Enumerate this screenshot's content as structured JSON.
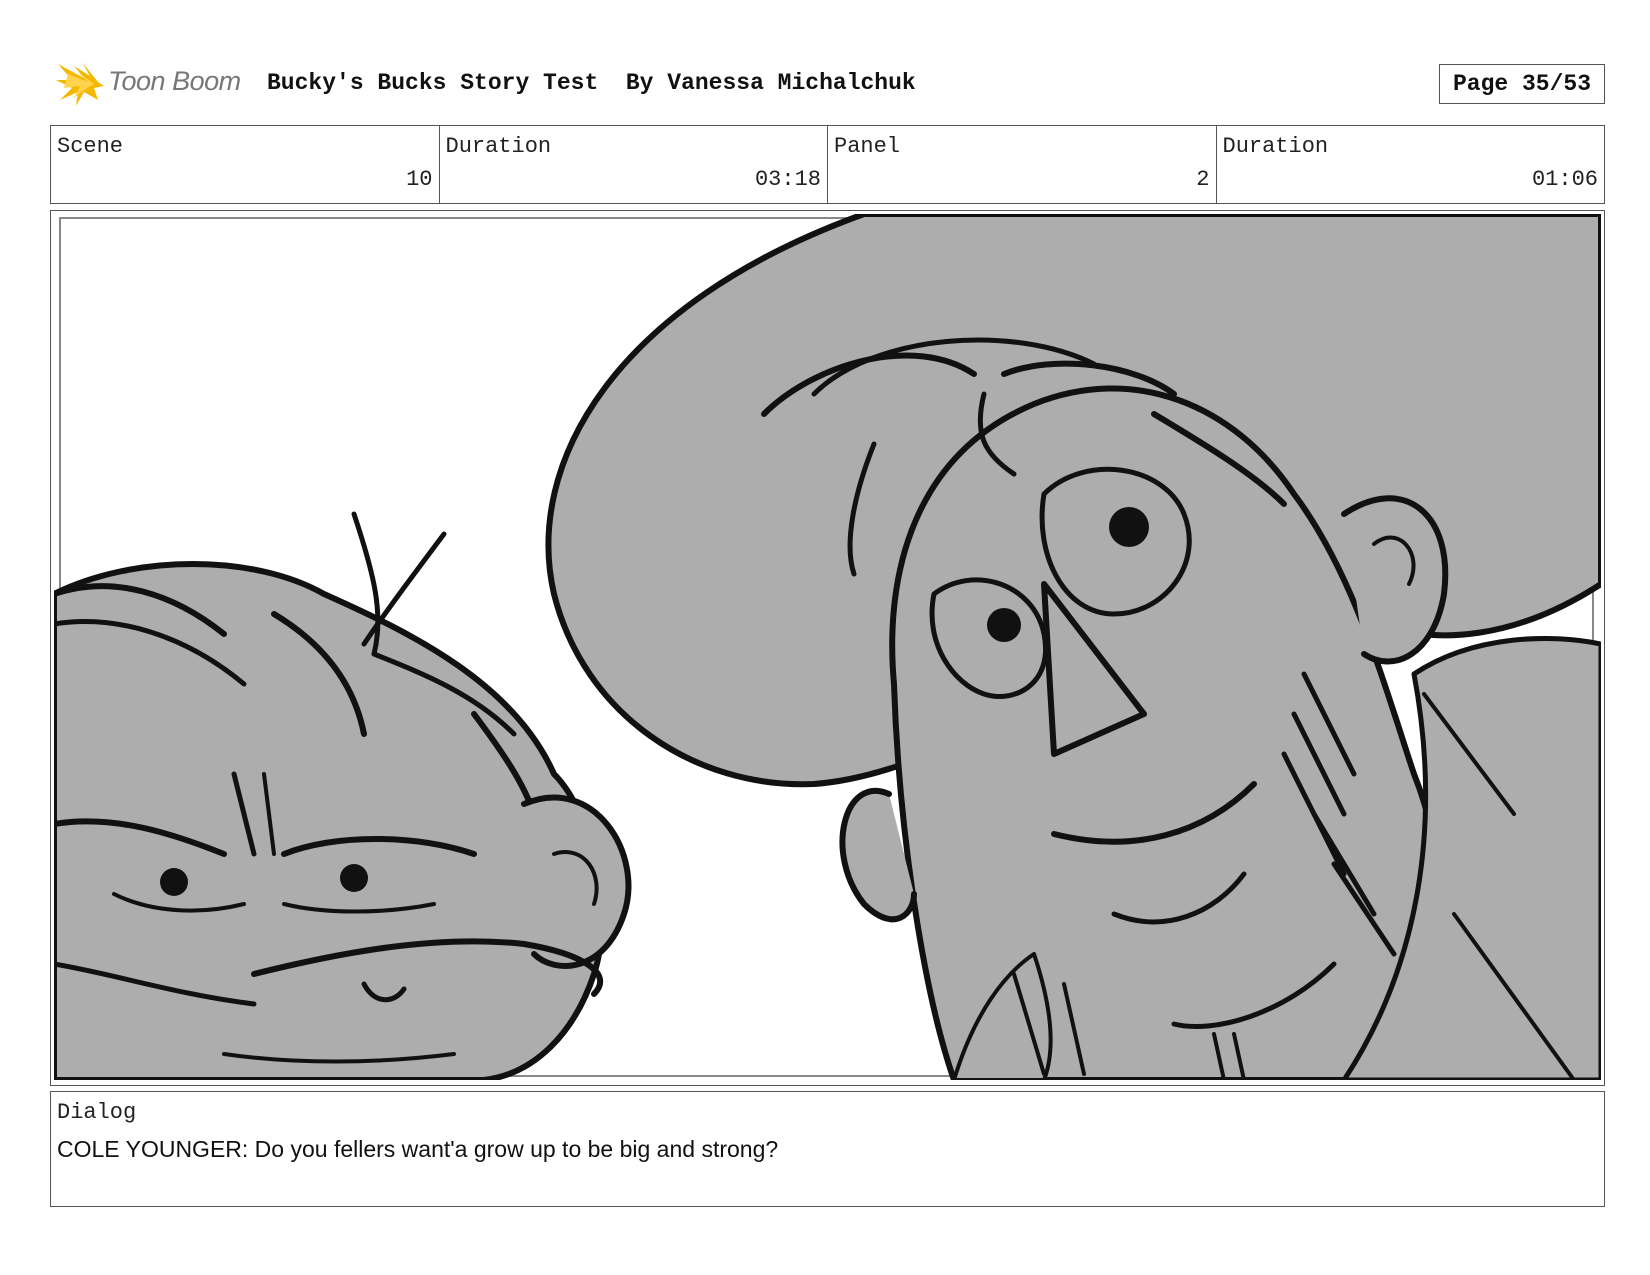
{
  "header": {
    "logo_text": "Toon Boom",
    "title": "Bucky's Bucks Story Test  By Vanessa Michalchuk",
    "page": "Page 35/53"
  },
  "info": {
    "scene_label": "Scene",
    "scene_value": "10",
    "scene_duration_label": "Duration",
    "scene_duration_value": "03:18",
    "panel_label": "Panel",
    "panel_value": "2",
    "panel_duration_label": "Duration",
    "panel_duration_value": "01:06"
  },
  "dialog": {
    "label": "Dialog",
    "text": "COLE YOUNGER: Do you fellers want'a grow up to be big and strong?"
  },
  "colors": {
    "sketch_fill": "#adadad",
    "ink": "#111111",
    "logo_accent": "#f5b800"
  },
  "panel_image": {
    "description_icon": "storyboard-sketch"
  }
}
